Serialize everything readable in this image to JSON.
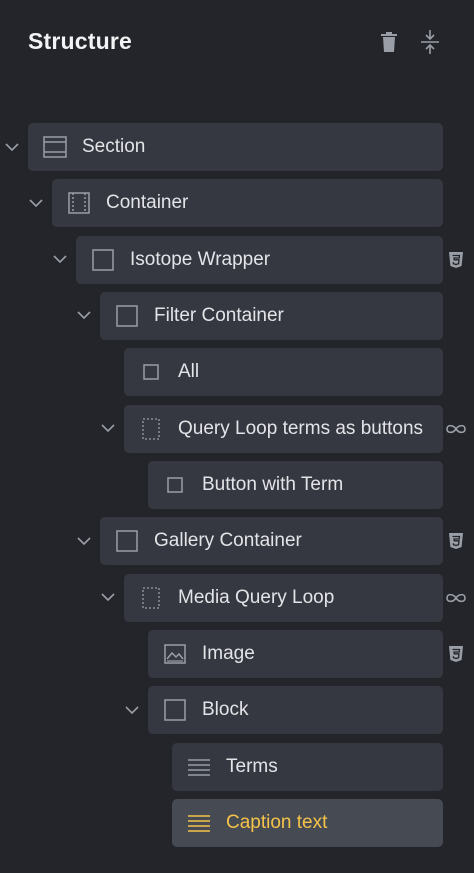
{
  "panel": {
    "title": "Structure"
  },
  "colors": {
    "background": "#23252a",
    "item": "#353840",
    "selected_item": "#464a53",
    "selected_text": "#f5c349",
    "icon": "#9a9ea6"
  },
  "tree": [
    {
      "label": "Section",
      "icon": "section-icon",
      "chevron": true
    },
    {
      "label": "Container",
      "icon": "container-icon",
      "chevron": true
    },
    {
      "label": "Isotope Wrapper",
      "icon": "div-icon",
      "chevron": true,
      "badge": "css-badge-icon"
    },
    {
      "label": "Filter Container",
      "icon": "div-icon",
      "chevron": true
    },
    {
      "label": "All",
      "icon": "button-icon",
      "chevron": false
    },
    {
      "label": "Query Loop terms as buttons",
      "icon": "loop-box-icon",
      "chevron": true,
      "badge": "infinity-icon"
    },
    {
      "label": "Button with Term",
      "icon": "button-icon",
      "chevron": false
    },
    {
      "label": "Gallery Container",
      "icon": "div-icon",
      "chevron": true,
      "badge": "css-badge-icon"
    },
    {
      "label": "Media Query Loop",
      "icon": "loop-box-icon",
      "chevron": true,
      "badge": "infinity-icon"
    },
    {
      "label": "Image",
      "icon": "image-icon",
      "chevron": false,
      "badge": "css-badge-icon"
    },
    {
      "label": "Block",
      "icon": "div-icon",
      "chevron": true
    },
    {
      "label": "Terms",
      "icon": "text-lines-icon",
      "chevron": false
    },
    {
      "label": "Caption text",
      "icon": "text-lines-icon",
      "chevron": false,
      "selected": true
    }
  ]
}
